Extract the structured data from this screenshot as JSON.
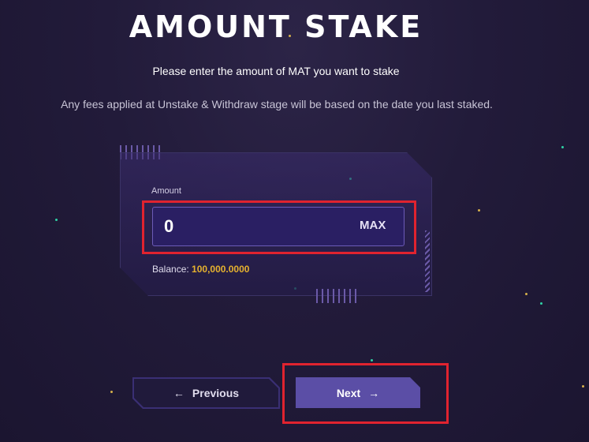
{
  "page": {
    "title": "AMOUNT STAKE",
    "subtitle": "Please enter the amount of MAT you want to stake",
    "note": "Any fees applied at Unstake & Withdraw stage will be based on the date you last staked."
  },
  "form": {
    "amount_label": "Amount",
    "amount_value": "0",
    "max_label": "MAX",
    "balance_label": "Balance:",
    "balance_value": "100,000.0000"
  },
  "nav": {
    "previous_label": "Previous",
    "next_label": "Next",
    "previous_icon": "arrow-left-icon",
    "next_icon": "arrow-right-icon"
  },
  "colors": {
    "background": "#221b3a",
    "accent": "#5b4ea6",
    "input_bg": "#2a1f63",
    "balance_value": "#e6b22e",
    "highlight": "#e0232f"
  }
}
